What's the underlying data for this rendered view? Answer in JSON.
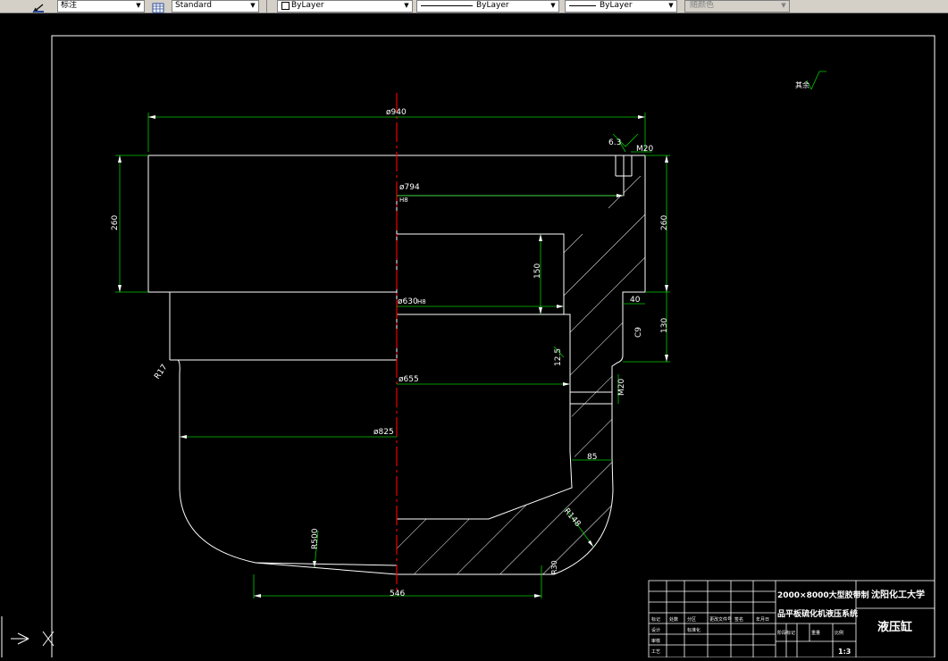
{
  "toolbar": {
    "dimstyle": "标注",
    "tablestyle": "Standard",
    "layer": "ByLayer",
    "linetype": "ByLayer",
    "lineweight": "ByLayer",
    "plotstyle": "随颜色"
  },
  "drawing": {
    "dims": {
      "d940": "ø940",
      "d794": "ø794",
      "d794_tol": "H8",
      "d630": "ø630",
      "d630_tol": "H8",
      "d655": "ø655",
      "d825": "ø825",
      "h260_left": "260",
      "h260_right": "260",
      "h150": "150",
      "h130": "130",
      "w40": "40",
      "w85": "85",
      "w546": "546",
      "r500": "R500",
      "r148": "R148",
      "r17": "R17",
      "r30": "R30",
      "m20_top": "M20",
      "m20_side": "M20",
      "c9": "C9",
      "rough_63": "6.3",
      "rough_125": "12.5"
    },
    "surface_note": "其余"
  },
  "title_block": {
    "project_line1": "2000×8000大型胶带制",
    "project_line2": "品平板硫化机液压系统",
    "university": "沈阳化工大学",
    "part_name": "液压缸",
    "scale": "1:3",
    "header_cells": [
      "标记",
      "处数",
      "分区",
      "更改文件号",
      "签名",
      "年月日"
    ],
    "row_labels": [
      "设计",
      "审核",
      "工艺"
    ],
    "cell_std": "标准化",
    "cell_stage": "阶段标记",
    "cell_weight": "重量",
    "cell_ratio": "比例"
  }
}
